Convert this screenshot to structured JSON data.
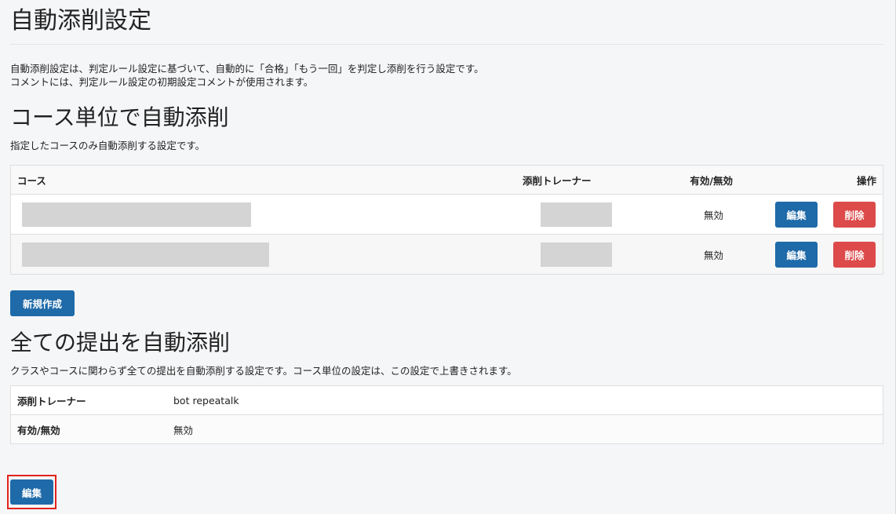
{
  "page": {
    "title": "自動添削設定",
    "description": [
      "自動添削設定は、判定ルール設定に基づいて、自動的に「合格」「もう一回」を判定し添削を行う設定です。",
      "コメントには、判定ルール設定の初期設定コメントが使用されます。"
    ]
  },
  "course_section": {
    "title": "コース単位で自動添削",
    "note": "指定したコースのみ自動添削する設定です。",
    "columns": {
      "course": "コース",
      "trainer": "添削トレーナー",
      "status": "有効/無効",
      "actions": "操作"
    },
    "rows": [
      {
        "course": "",
        "trainer": "",
        "status": "無効",
        "edit_label": "編集",
        "delete_label": "削除"
      },
      {
        "course": "",
        "trainer": "",
        "status": "無効",
        "edit_label": "編集",
        "delete_label": "削除"
      }
    ],
    "new_button": "新規作成"
  },
  "all_section": {
    "title": "全ての提出を自動添削",
    "note": "クラスやコースに関わらず全ての提出を自動添削する設定です。コース単位の設定は、この設定で上書きされます。",
    "fields": [
      {
        "label": "添削トレーナー",
        "value": "bot repeatalk"
      },
      {
        "label": "有効/無効",
        "value": "無効"
      }
    ],
    "edit_button": "編集"
  },
  "colors": {
    "primary": "#1f6aa8",
    "danger": "#dc4a4a",
    "highlight": "#e2231a"
  }
}
